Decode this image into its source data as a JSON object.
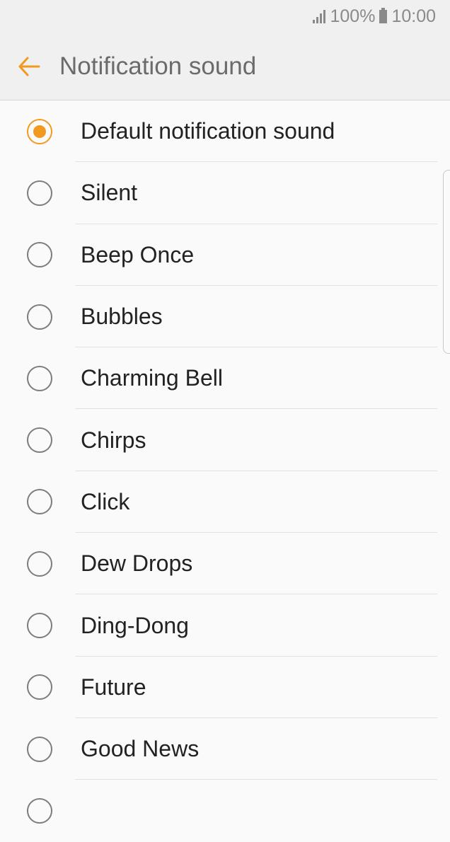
{
  "status_bar": {
    "battery_percent": "100%",
    "time": "10:00"
  },
  "header": {
    "title": "Notification sound",
    "accent_color": "#f29a1f"
  },
  "list": {
    "selected_index": 0,
    "items": [
      {
        "label": "Default notification sound",
        "selected": true
      },
      {
        "label": "Silent",
        "selected": false
      },
      {
        "label": "Beep Once",
        "selected": false
      },
      {
        "label": "Bubbles",
        "selected": false
      },
      {
        "label": "Charming Bell",
        "selected": false
      },
      {
        "label": "Chirps",
        "selected": false
      },
      {
        "label": "Click",
        "selected": false
      },
      {
        "label": "Dew Drops",
        "selected": false
      },
      {
        "label": "Ding-Dong",
        "selected": false
      },
      {
        "label": "Future",
        "selected": false
      },
      {
        "label": "Good News",
        "selected": false
      },
      {
        "label": "",
        "selected": false
      }
    ]
  }
}
